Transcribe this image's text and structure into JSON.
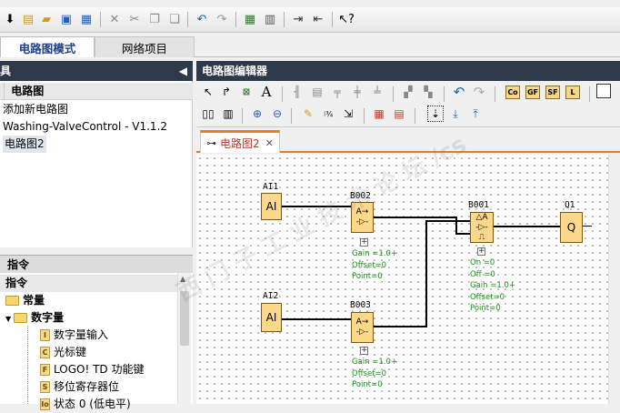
{
  "menubar": {
    "partial": "⋯"
  },
  "mode_tabs": {
    "circuit_mode": "电路图模式",
    "network_project": "网络项目"
  },
  "left_panel": {
    "header": "具",
    "collapse_glyph": "◀",
    "tree_title": "电路图",
    "items": [
      "添加新电路图",
      "Washing-ValveControl - V1.1.2",
      "电路图2"
    ]
  },
  "instructions": {
    "header": "指令",
    "root": "指令",
    "constants": "常量",
    "digital": "数字量",
    "children": [
      {
        "icon": "I",
        "label": "数字量输入"
      },
      {
        "icon": "C",
        "label": "光标键"
      },
      {
        "icon": "F",
        "label": "LOGO! TD 功能键"
      },
      {
        "icon": "S",
        "label": "移位寄存器位"
      },
      {
        "icon": "Io",
        "label": "状态 0 (低电平)"
      }
    ]
  },
  "editor": {
    "header": "电路图编辑器",
    "yellow_buttons": [
      "Co",
      "GF",
      "SF",
      "L"
    ]
  },
  "doc_tab": {
    "label": "电路图2",
    "close": "✕"
  },
  "diagram": {
    "ai1": {
      "name": "AI1",
      "type": "AI"
    },
    "ai2": {
      "name": "AI2",
      "type": "AI"
    },
    "b002": {
      "name": "B002",
      "params": [
        "Gain =1.0+",
        "Offset=0",
        "Point=0"
      ]
    },
    "b003": {
      "name": "B003",
      "params": [
        "Gain =1.0+",
        "Offset=0",
        "Point=0"
      ]
    },
    "b001": {
      "name": "B001",
      "params": [
        "On   =0",
        "Off   =0",
        "Gain =1.0+",
        "Offset=0",
        "Point=0"
      ]
    },
    "q1": {
      "name": "Q1",
      "type": "Q"
    }
  },
  "watermark": "西 门 子 工 业 技 术 论 坛 /cs"
}
